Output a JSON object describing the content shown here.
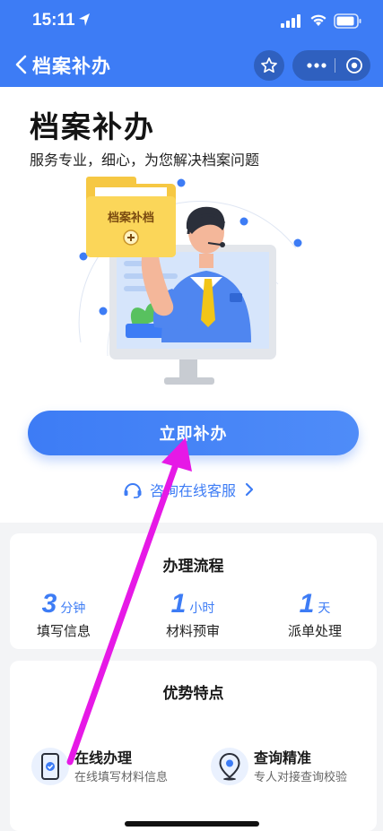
{
  "status_bar": {
    "time": "15:11"
  },
  "nav": {
    "title": "档案补办"
  },
  "hero": {
    "title": "档案补办",
    "subtitle": "服务专业，细心，为您解决档案问题",
    "folder_label": "档案补档",
    "cta_label": "立即补办",
    "consult_label": "咨询在线客服"
  },
  "process": {
    "title": "办理流程",
    "steps": [
      {
        "num": "3",
        "unit": "分钟",
        "label": "填写信息"
      },
      {
        "num": "1",
        "unit": "小时",
        "label": "材料预审"
      },
      {
        "num": "1",
        "unit": "天",
        "label": "派单处理"
      }
    ]
  },
  "advantages": {
    "title": "优势特点",
    "items": [
      {
        "title": "在线办理",
        "desc": "在线填写材料信息",
        "icon": "phone-check-icon"
      },
      {
        "title": "查询精准",
        "desc": "专人对接查询校验",
        "icon": "location-pin-icon"
      }
    ]
  },
  "colors": {
    "primary": "#3d7cf5",
    "annotation_arrow": "#e619e6"
  }
}
